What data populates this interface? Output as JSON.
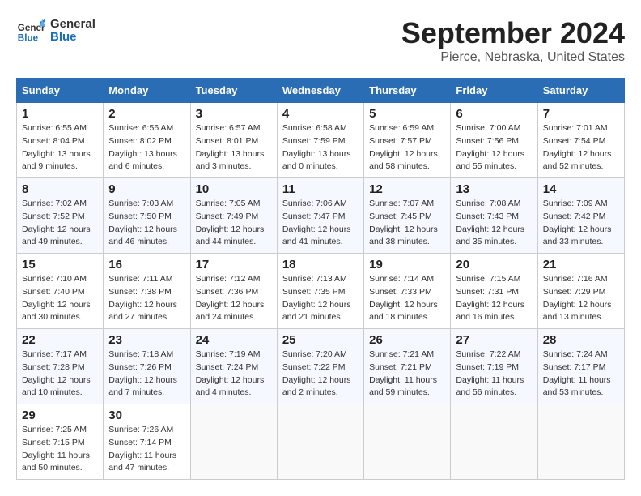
{
  "logo": {
    "line1": "General",
    "line2": "Blue"
  },
  "title": "September 2024",
  "subtitle": "Pierce, Nebraska, United States",
  "weekdays": [
    "Sunday",
    "Monday",
    "Tuesday",
    "Wednesday",
    "Thursday",
    "Friday",
    "Saturday"
  ],
  "weeks": [
    [
      {
        "day": 1,
        "sunrise": "6:55 AM",
        "sunset": "8:04 PM",
        "daylight": "13 hours and 9 minutes."
      },
      {
        "day": 2,
        "sunrise": "6:56 AM",
        "sunset": "8:02 PM",
        "daylight": "13 hours and 6 minutes."
      },
      {
        "day": 3,
        "sunrise": "6:57 AM",
        "sunset": "8:01 PM",
        "daylight": "13 hours and 3 minutes."
      },
      {
        "day": 4,
        "sunrise": "6:58 AM",
        "sunset": "7:59 PM",
        "daylight": "13 hours and 0 minutes."
      },
      {
        "day": 5,
        "sunrise": "6:59 AM",
        "sunset": "7:57 PM",
        "daylight": "12 hours and 58 minutes."
      },
      {
        "day": 6,
        "sunrise": "7:00 AM",
        "sunset": "7:56 PM",
        "daylight": "12 hours and 55 minutes."
      },
      {
        "day": 7,
        "sunrise": "7:01 AM",
        "sunset": "7:54 PM",
        "daylight": "12 hours and 52 minutes."
      }
    ],
    [
      {
        "day": 8,
        "sunrise": "7:02 AM",
        "sunset": "7:52 PM",
        "daylight": "12 hours and 49 minutes."
      },
      {
        "day": 9,
        "sunrise": "7:03 AM",
        "sunset": "7:50 PM",
        "daylight": "12 hours and 46 minutes."
      },
      {
        "day": 10,
        "sunrise": "7:05 AM",
        "sunset": "7:49 PM",
        "daylight": "12 hours and 44 minutes."
      },
      {
        "day": 11,
        "sunrise": "7:06 AM",
        "sunset": "7:47 PM",
        "daylight": "12 hours and 41 minutes."
      },
      {
        "day": 12,
        "sunrise": "7:07 AM",
        "sunset": "7:45 PM",
        "daylight": "12 hours and 38 minutes."
      },
      {
        "day": 13,
        "sunrise": "7:08 AM",
        "sunset": "7:43 PM",
        "daylight": "12 hours and 35 minutes."
      },
      {
        "day": 14,
        "sunrise": "7:09 AM",
        "sunset": "7:42 PM",
        "daylight": "12 hours and 33 minutes."
      }
    ],
    [
      {
        "day": 15,
        "sunrise": "7:10 AM",
        "sunset": "7:40 PM",
        "daylight": "12 hours and 30 minutes."
      },
      {
        "day": 16,
        "sunrise": "7:11 AM",
        "sunset": "7:38 PM",
        "daylight": "12 hours and 27 minutes."
      },
      {
        "day": 17,
        "sunrise": "7:12 AM",
        "sunset": "7:36 PM",
        "daylight": "12 hours and 24 minutes."
      },
      {
        "day": 18,
        "sunrise": "7:13 AM",
        "sunset": "7:35 PM",
        "daylight": "12 hours and 21 minutes."
      },
      {
        "day": 19,
        "sunrise": "7:14 AM",
        "sunset": "7:33 PM",
        "daylight": "12 hours and 18 minutes."
      },
      {
        "day": 20,
        "sunrise": "7:15 AM",
        "sunset": "7:31 PM",
        "daylight": "12 hours and 16 minutes."
      },
      {
        "day": 21,
        "sunrise": "7:16 AM",
        "sunset": "7:29 PM",
        "daylight": "12 hours and 13 minutes."
      }
    ],
    [
      {
        "day": 22,
        "sunrise": "7:17 AM",
        "sunset": "7:28 PM",
        "daylight": "12 hours and 10 minutes."
      },
      {
        "day": 23,
        "sunrise": "7:18 AM",
        "sunset": "7:26 PM",
        "daylight": "12 hours and 7 minutes."
      },
      {
        "day": 24,
        "sunrise": "7:19 AM",
        "sunset": "7:24 PM",
        "daylight": "12 hours and 4 minutes."
      },
      {
        "day": 25,
        "sunrise": "7:20 AM",
        "sunset": "7:22 PM",
        "daylight": "12 hours and 2 minutes."
      },
      {
        "day": 26,
        "sunrise": "7:21 AM",
        "sunset": "7:21 PM",
        "daylight": "11 hours and 59 minutes."
      },
      {
        "day": 27,
        "sunrise": "7:22 AM",
        "sunset": "7:19 PM",
        "daylight": "11 hours and 56 minutes."
      },
      {
        "day": 28,
        "sunrise": "7:24 AM",
        "sunset": "7:17 PM",
        "daylight": "11 hours and 53 minutes."
      }
    ],
    [
      {
        "day": 29,
        "sunrise": "7:25 AM",
        "sunset": "7:15 PM",
        "daylight": "11 hours and 50 minutes."
      },
      {
        "day": 30,
        "sunrise": "7:26 AM",
        "sunset": "7:14 PM",
        "daylight": "11 hours and 47 minutes."
      },
      null,
      null,
      null,
      null,
      null
    ]
  ],
  "labels": {
    "sunrise": "Sunrise:",
    "sunset": "Sunset:",
    "daylight": "Daylight:"
  }
}
